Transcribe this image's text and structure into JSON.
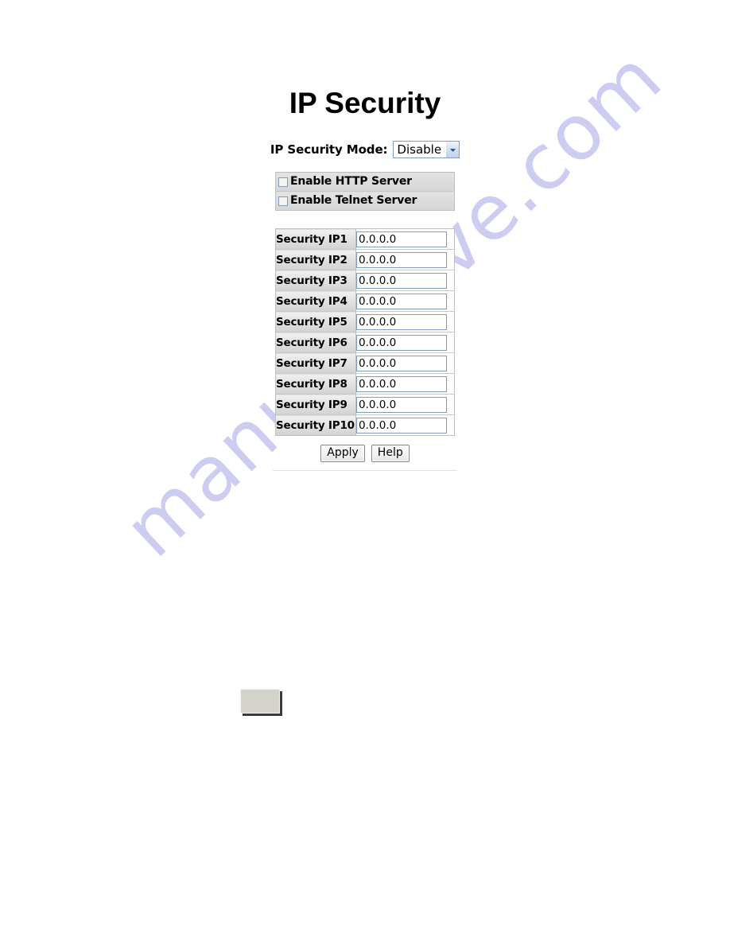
{
  "page": {
    "title": "IP Security"
  },
  "mode": {
    "label": "IP Security Mode:",
    "selected": "Disable",
    "options": [
      "Disable"
    ],
    "arrow_icon": "chevron-down-icon"
  },
  "servers": {
    "rows": [
      {
        "label": "Enable HTTP Server",
        "checked": false
      },
      {
        "label": "Enable Telnet Server",
        "checked": false
      }
    ]
  },
  "security_ips": {
    "rows": [
      {
        "label": "Security IP1",
        "value": "0.0.0.0"
      },
      {
        "label": "Security IP2",
        "value": "0.0.0.0"
      },
      {
        "label": "Security IP3",
        "value": "0.0.0.0"
      },
      {
        "label": "Security IP4",
        "value": "0.0.0.0"
      },
      {
        "label": "Security IP5",
        "value": "0.0.0.0"
      },
      {
        "label": "Security IP6",
        "value": "0.0.0.0"
      },
      {
        "label": "Security IP7",
        "value": "0.0.0.0"
      },
      {
        "label": "Security IP8",
        "value": "0.0.0.0"
      },
      {
        "label": "Security IP9",
        "value": "0.0.0.0"
      },
      {
        "label": "Security IP10",
        "value": "0.0.0.0"
      }
    ]
  },
  "buttons": {
    "apply": "Apply",
    "help": "Help"
  },
  "watermark": {
    "text": "manualshive.com",
    "color": "#cdcdf2"
  },
  "colors": {
    "input_border": "#7f9db9",
    "label_cell_bg": "#e3e3e3",
    "server_row_bg": "#dcdcdc",
    "text": "#000000",
    "background": "#ffffff"
  }
}
